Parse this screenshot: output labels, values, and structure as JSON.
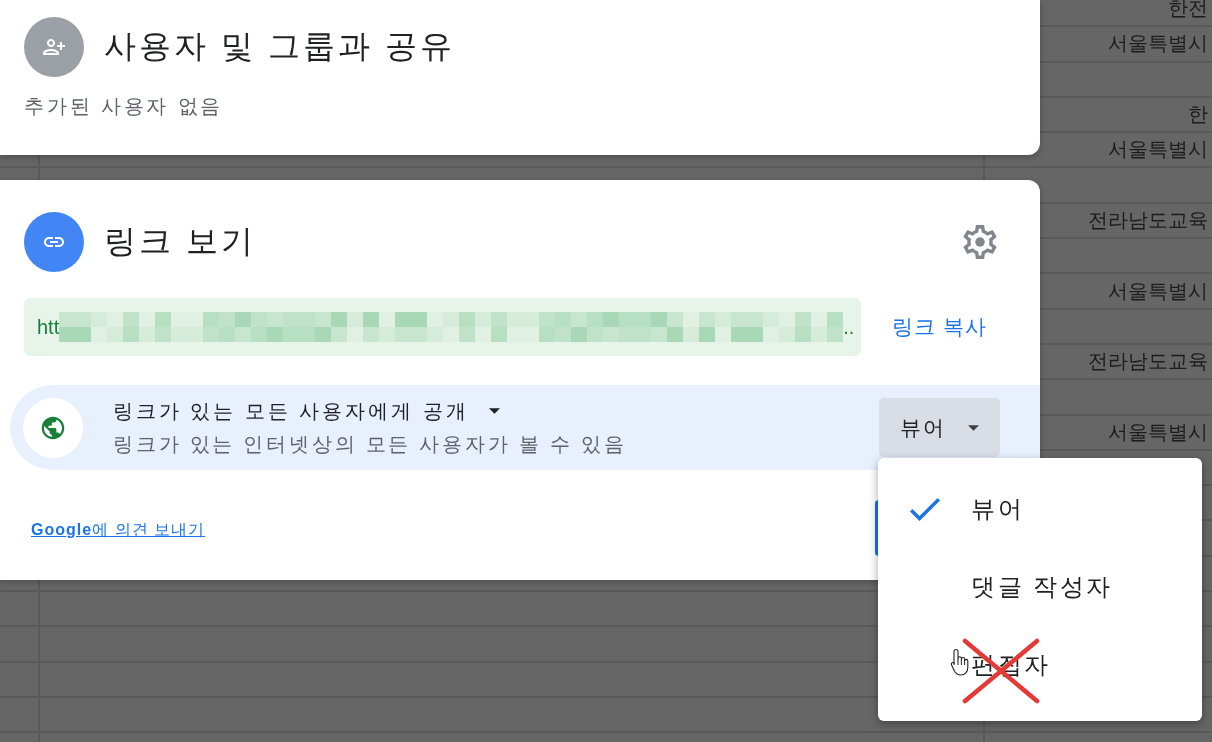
{
  "background_sheet": {
    "rows": [
      {
        "column_3": "한전"
      },
      {
        "column_3": "서울특별시"
      },
      {},
      {
        "column_3": "한"
      },
      {
        "column_3": "서울특별시"
      },
      {},
      {
        "column_3": "전라남도교육"
      },
      {},
      {
        "column_3": "서울특별시"
      },
      {},
      {
        "column_3": "전라남도교육"
      },
      {},
      {
        "column_3": "서울특별시"
      },
      {},
      {},
      {},
      {},
      {},
      {},
      {},
      {},
      {}
    ]
  },
  "share_card": {
    "title": "사용자 및 그룹과 공유",
    "status": "추가된 사용자 없음"
  },
  "link_card": {
    "title": "링크 보기",
    "url_start": "htt",
    "url_end": "..",
    "copy_link": "링크 복사",
    "access": {
      "title": "링크가 있는 모든 사용자에게 공개",
      "description": "링크가 있는 인터넷상의 모든 사용자가 볼 수 있음",
      "role": "뷰어"
    },
    "feedback_link": "**Google**에 의견 보내기"
  },
  "role_menu": {
    "items": [
      {
        "label": "뷰어",
        "selected": true,
        "crossed_out": false,
        "hovered": false
      },
      {
        "label": "댓글 작성자",
        "selected": false,
        "crossed_out": false,
        "hovered": false
      },
      {
        "label": "편집자",
        "selected": false,
        "crossed_out": true,
        "hovered": true
      }
    ]
  }
}
